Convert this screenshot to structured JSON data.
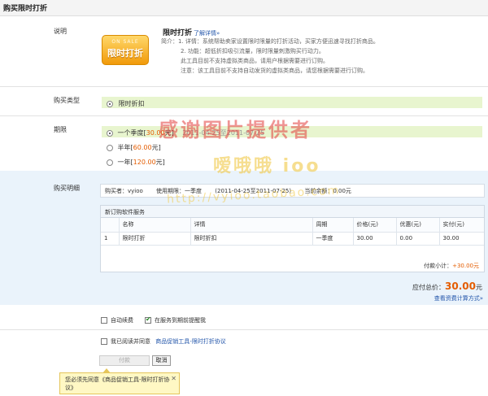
{
  "page_title": "购买限时打折",
  "description": {
    "label": "说明",
    "logo_top": "ON SALE",
    "logo_text": "限时打折",
    "title": "限时打折",
    "more_link": "了解详情»",
    "lines": [
      "简介：1. 详情：系统帮助卖家设置限时限量的打折活动，买家方便迅速寻找打折商品。",
      "2. 功能：超低折扣吸引流量，限时限量刺激购买行动力。",
      "此工具目前不支持虚拟类商品，请用户根据需要进行订购。",
      "注意：该工具目前不支持自动发货的虚拟类商品，请您根据需要进行订购。"
    ]
  },
  "purchase_type": {
    "label": "购买类型",
    "option": "限时折扣"
  },
  "period": {
    "label": "期限",
    "options": [
      {
        "text": "一个季度[",
        "price": "30.00",
        "unit": "元]",
        "dates": "2011-04-25至2011-07-25",
        "selected": true
      },
      {
        "text": "半年[",
        "price": "60.00",
        "unit": "元]",
        "dates": "",
        "selected": false
      },
      {
        "text": "一年[",
        "price": "120.00",
        "unit": "元]",
        "dates": "",
        "selected": false
      }
    ]
  },
  "details": {
    "label": "购买明细",
    "buyer": "购买者：vyioo",
    "usage": "使用期限：一季度",
    "range": "(2011-04-25至2011-07-25)",
    "balance": "当前余额：0.00元",
    "box_title": "新订购软件服务",
    "columns": [
      "",
      "名称",
      "详情",
      "周期",
      "价格(元)",
      "优惠(元)",
      "实付(元)"
    ],
    "rows": [
      [
        "1",
        "限时打折",
        "限时折扣",
        "一季度",
        "30.00",
        "0.00",
        "30.00"
      ]
    ],
    "subtotal_label": "付款小计：",
    "subtotal_value": "+30.00元"
  },
  "total": {
    "label": "应付总价：",
    "value": "30.00",
    "unit": "元",
    "calc_link": "查看资费计算方式»"
  },
  "options": {
    "auto_renew": "自动续费",
    "remind": "在服务到期前提醒我",
    "agree_prefix": "我已阅读并同意",
    "agree_link": "商品促销工具-限时打折协议"
  },
  "buttons": {
    "pay": "付款",
    "cancel": "取消"
  },
  "tooltip": "您必须先同意《商品促销工具-限时打折协议》",
  "watermark": {
    "line1": "感谢图片提供者",
    "line2": "嗳哦哦 ioo",
    "line3": "http://vyioo.taobao.com"
  },
  "colors": {
    "accent": "#e45c00",
    "link": "#2255aa",
    "green_bar": "#e8f5cf",
    "detail_bg": "#eaf3fb"
  }
}
